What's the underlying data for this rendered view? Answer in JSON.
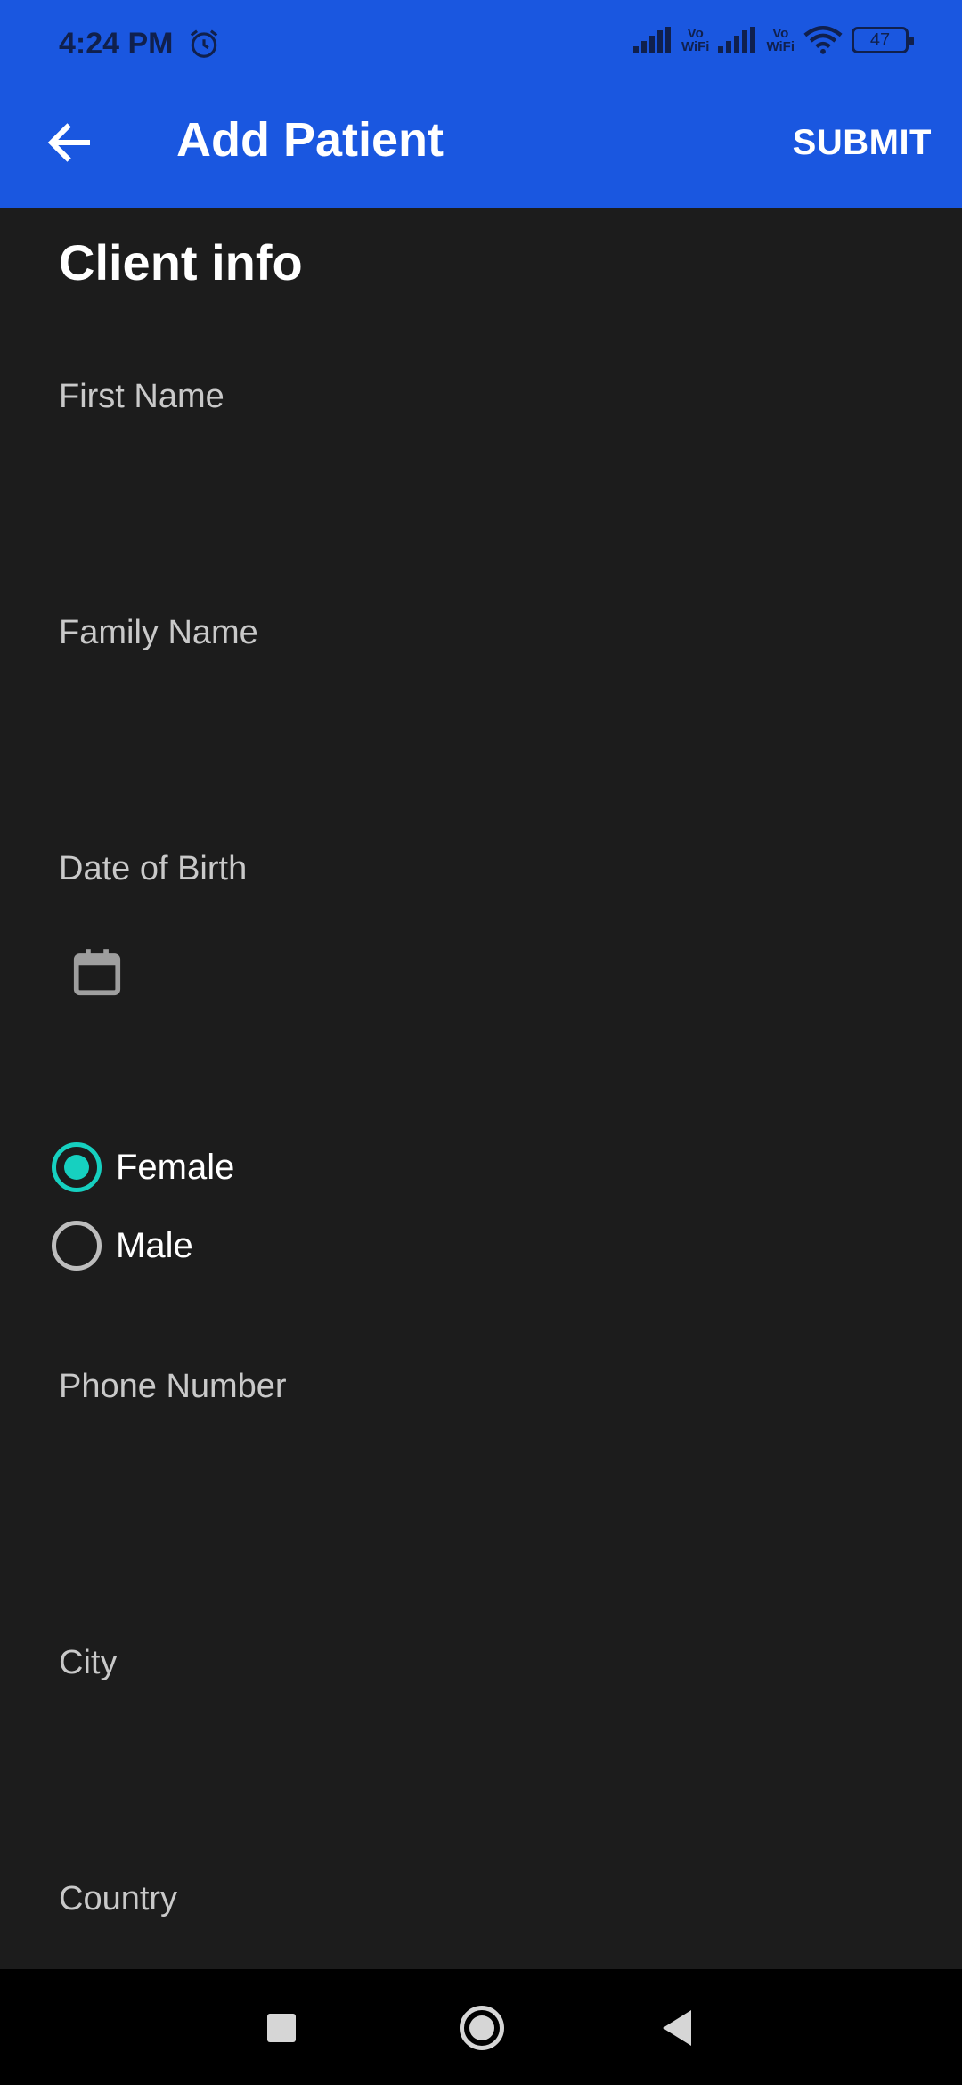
{
  "status_bar": {
    "time": "4:24 PM",
    "wifi_calling_1": "Vo\nWiFi",
    "wifi_calling_2": "Vo\nWiFi",
    "battery": "47",
    "icons": [
      "alarm-icon",
      "signal-icon",
      "vowifi-icon",
      "signal-icon",
      "vowifi-icon",
      "wifi-icon",
      "battery-icon"
    ]
  },
  "app_bar": {
    "title": "Add Patient",
    "submit_label": "SUBMIT",
    "back_icon": "arrow-left-icon"
  },
  "form": {
    "section_title": "Client info",
    "first_name": {
      "label": "First Name",
      "value": ""
    },
    "family_name": {
      "label": "Family Name",
      "value": ""
    },
    "date_of_birth": {
      "label": "Date of Birth",
      "icon": "calendar-icon"
    },
    "gender": {
      "options": [
        {
          "label": "Female",
          "selected": true
        },
        {
          "label": "Male",
          "selected": false
        }
      ]
    },
    "phone_number": {
      "label": "Phone Number",
      "value": ""
    },
    "city": {
      "label": "City",
      "value": ""
    },
    "country": {
      "label": "Country",
      "value": ""
    }
  },
  "colors": {
    "app_bar": "#1a57e0",
    "background": "#1c1c1c",
    "accent_radio": "#16d0c0",
    "label_text": "#c9c9c9"
  },
  "nav_bar": {
    "icons": [
      "recents-square-icon",
      "home-circle-icon",
      "back-triangle-icon"
    ]
  }
}
